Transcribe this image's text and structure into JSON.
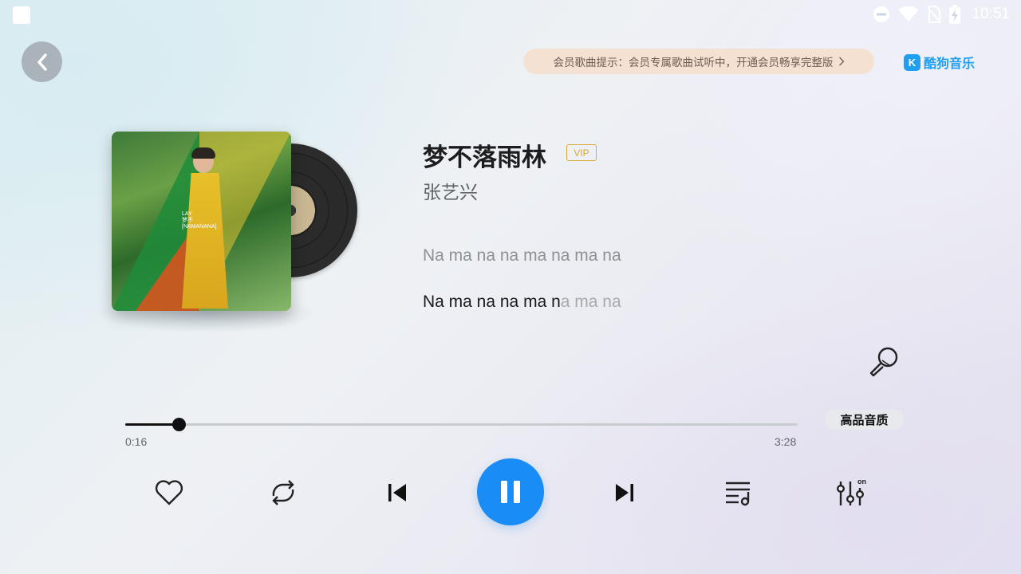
{
  "status_bar": {
    "time": "10:51"
  },
  "header": {
    "vip_notice": "会员歌曲提示：会员专属歌曲试听中，开通会员畅享完整版",
    "brand_name": "酷狗音乐",
    "brand_badge": "K"
  },
  "song": {
    "title": "梦不落雨林",
    "vip_tag": "VIP",
    "artist": "张艺兴",
    "cover_text": [
      "LAY",
      "梦不",
      "[NAMANANA]"
    ]
  },
  "lyrics": {
    "previous_line": "Na ma na na ma na ma na",
    "current_sung": "Na ma na na ma n",
    "current_rest": "a ma na"
  },
  "playback": {
    "current_time": "0:16",
    "total_time": "3:28",
    "progress_fraction": 0.08,
    "quality_label": "高品音质",
    "state": "playing"
  },
  "controls": [
    "heart-icon",
    "repeat-icon",
    "previous-icon",
    "pause-icon",
    "next-icon",
    "playlist-icon",
    "equalizer-icon"
  ],
  "colors": {
    "accent": "#1a8cf5",
    "vip": "#d8a93c",
    "brand": "#1e9ff0"
  }
}
